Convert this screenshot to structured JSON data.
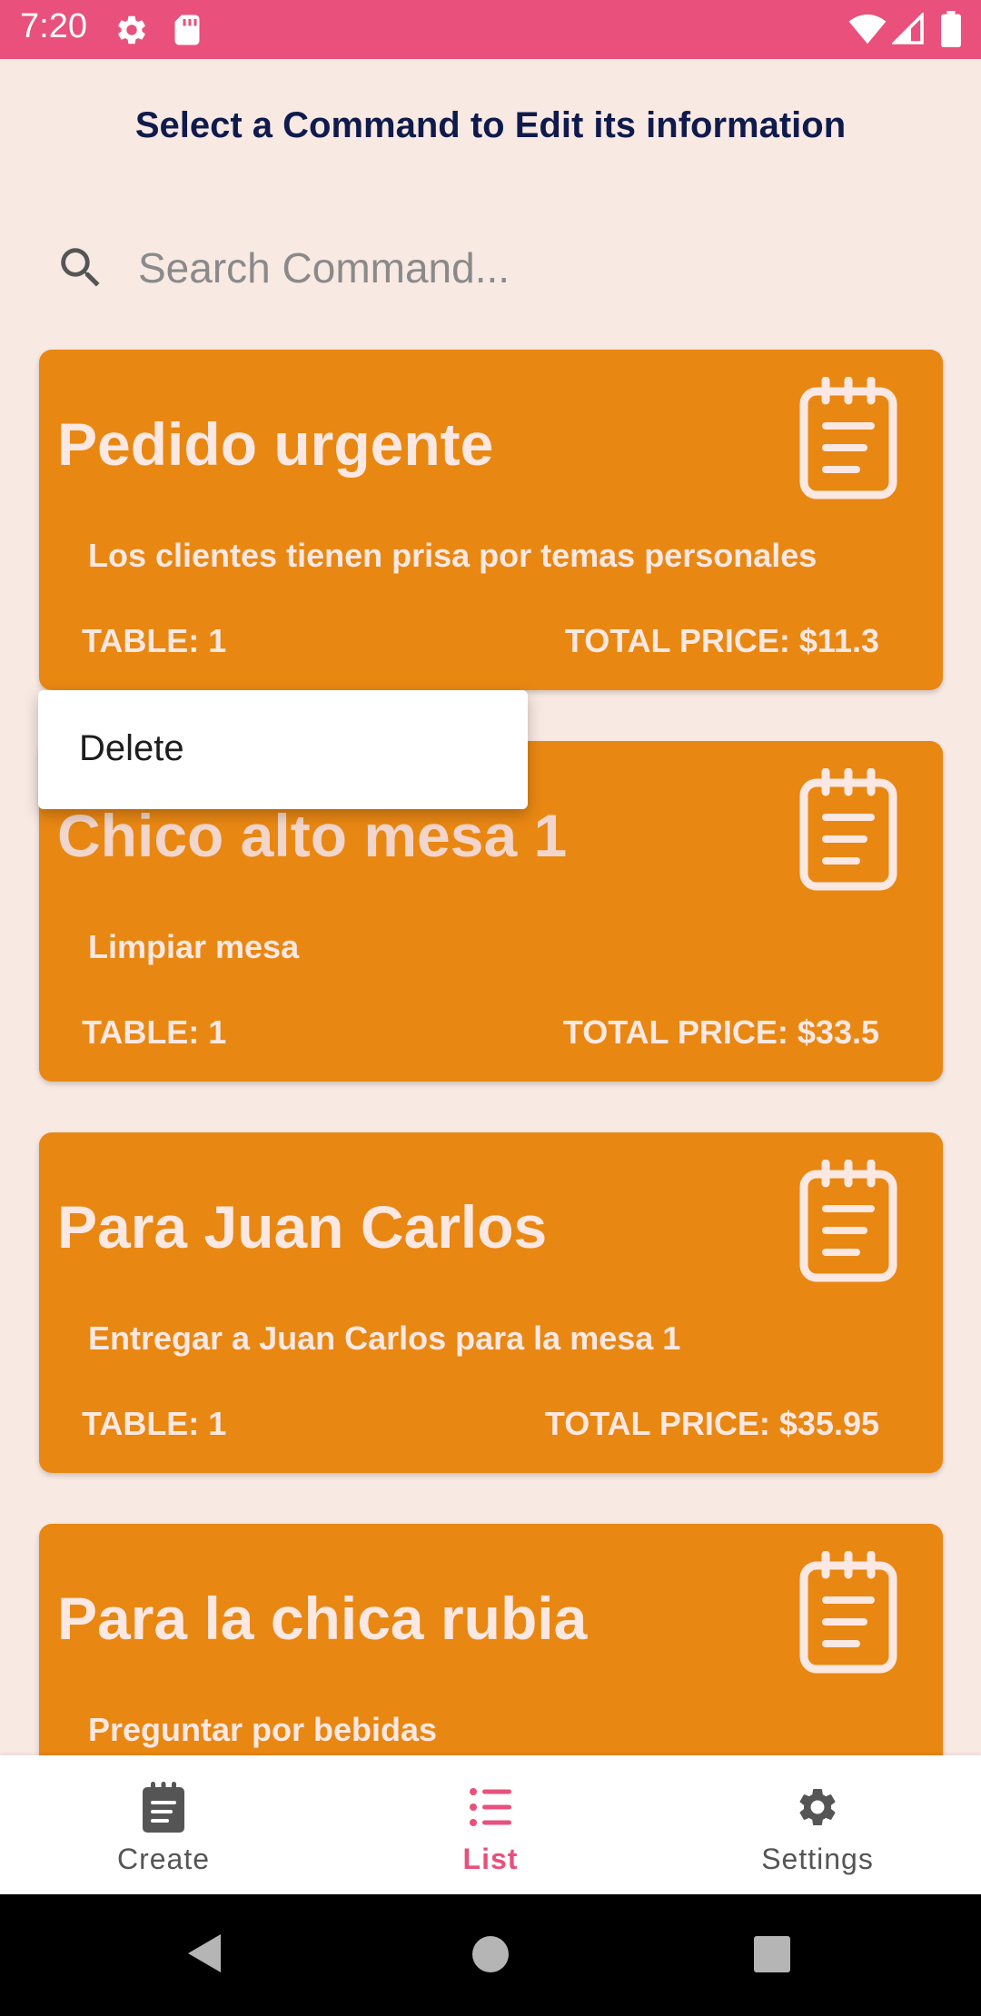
{
  "status_bar": {
    "time": "7:20",
    "color": "#e9507c"
  },
  "header": {
    "title": "Select a Command to Edit its information"
  },
  "search": {
    "placeholder": "Search Command...",
    "value": "",
    "icon": "search-icon"
  },
  "commands": [
    {
      "title": "Pedido urgente",
      "description": "Los clientes tienen prisa por temas personales",
      "table": "TABLE: 1",
      "price": "TOTAL PRICE: $11.3",
      "icon": "notepad-icon"
    },
    {
      "title": "Chico alto mesa 1",
      "description": "Limpiar mesa",
      "table": "TABLE: 1",
      "price": "TOTAL PRICE: $33.5",
      "icon": "notepad-icon"
    },
    {
      "title": "Para Juan Carlos",
      "description": "Entregar a Juan Carlos para la mesa 1",
      "table": "TABLE: 1",
      "price": "TOTAL PRICE: $35.95",
      "icon": "notepad-icon"
    },
    {
      "title": "Para la chica rubia",
      "description": "Preguntar por bebidas",
      "icon": "notepad-icon"
    }
  ],
  "context_menu": {
    "items": [
      {
        "label": "Delete"
      }
    ]
  },
  "bottom_nav": {
    "items": [
      {
        "label": "Create",
        "icon": "notepad-icon",
        "active": false
      },
      {
        "label": "List",
        "icon": "list-icon",
        "active": true
      },
      {
        "label": "Settings",
        "icon": "gear-icon",
        "active": false
      }
    ]
  },
  "colors": {
    "background": "#f9e9e3",
    "card": "#e98713",
    "card_text": "#fbe8e2",
    "accent": "#e9507c",
    "title_text": "#0f1b4c"
  }
}
